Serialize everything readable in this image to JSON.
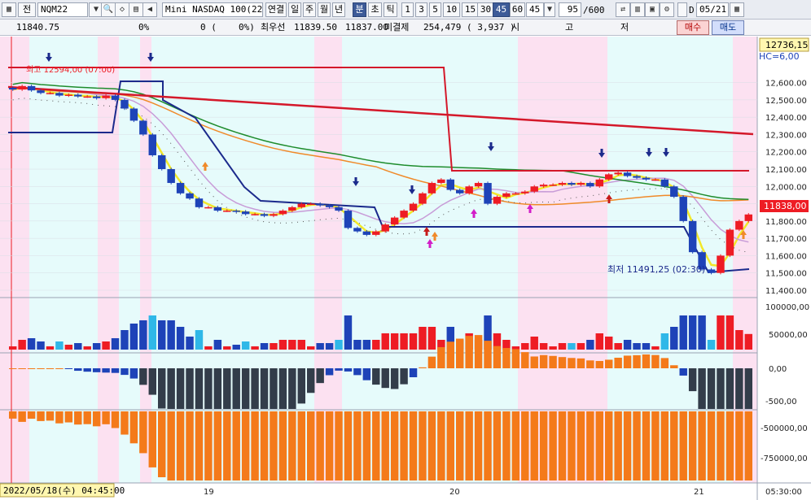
{
  "toolbar": {
    "code_prefix": "전",
    "code": "NQM22",
    "product": "Mini NASDAQ 100(22.0",
    "period_buttons": [
      "연결",
      "일",
      "주",
      "월",
      "년",
      "분",
      "초",
      "틱"
    ],
    "active_period": "분",
    "minute_buttons": [
      "1",
      "3",
      "5",
      "10",
      "15",
      "30",
      "45",
      "60"
    ],
    "active_minute": "45",
    "minute_input": "45",
    "count_input": "95",
    "count_total": "/600",
    "date_prefix": "D",
    "date": "05/21"
  },
  "quote": {
    "price": "11840.75",
    "pct": "0%",
    "change": "0 (",
    "change_pct": "0%)",
    "best_label": "최우선",
    "bid": "11839.50",
    "ask": "11837.00",
    "open_interest_label": "미결제",
    "open_interest": "254,479 ( 3,937 )",
    "open_label": "시",
    "high_label": "고",
    "low_label": "저",
    "buy": "매수",
    "sell": "매도"
  },
  "price_axis": {
    "ticks": [
      "12,600.00",
      "12,500.00",
      "12,400.00",
      "12,300.00",
      "12,200.00",
      "12,100.00",
      "12,000.00",
      "11,900.00",
      "11,800.00",
      "11,700.00",
      "11,600.00",
      "11,500.00",
      "11,400.00"
    ],
    "top_label": "12736,15",
    "indicator_label": "HC=6,00",
    "current_label": "11838,00"
  },
  "annotations": {
    "high_label": "최고 12594,00 (07:00)",
    "low_label": "최저 11491,25 (02:30)"
  },
  "volume_axis": {
    "ticks": [
      "100000,00",
      "50000,00"
    ]
  },
  "osc_axis": {
    "ticks": [
      "0,00",
      "-500,00"
    ]
  },
  "obv_axis": {
    "ticks": [
      "-500000,00",
      "-750000,00"
    ]
  },
  "time_axis": {
    "start_label": "2022/05/18(수) 04:45:00",
    "dates": [
      "19",
      "20",
      "21"
    ],
    "end_label": "05:30:00"
  },
  "colors": {
    "up": "#ee1c24",
    "down": "#1e43b8",
    "ma_yellow": "#f2e82a",
    "ma_purple": "#c89cd8",
    "ma_orange": "#f08a2a",
    "ma_green": "#1e8c2c",
    "ma_red": "#d4182a",
    "navy": "#1b2a8c",
    "osc_orange": "#f47a1a",
    "pink_band": "#fce1f1",
    "cyan_band": "#e6fbfb"
  },
  "chart_data": {
    "type": "candlestick",
    "title": "",
    "xlabel": "",
    "ylabel": "",
    "ylim": [
      11400,
      12650
    ],
    "x": [
      "05/18 04:45",
      "05/19",
      "05/20",
      "05/21"
    ],
    "series": [],
    "closes": [
      12560,
      12580,
      12555,
      12540,
      12540,
      12525,
      12530,
      12520,
      12520,
      12510,
      12525,
      12500,
      12450,
      12380,
      12300,
      12180,
      12100,
      12020,
      11960,
      11930,
      11880,
      11880,
      11860,
      11860,
      11855,
      11840,
      11840,
      11830,
      11840,
      11860,
      11880,
      11900,
      11900,
      11890,
      11880,
      11860,
      11760,
      11740,
      11720,
      11740,
      11780,
      11820,
      11860,
      11900,
      11960,
      12020,
      12040,
      11980,
      11960,
      12000,
      12020,
      11900,
      11940,
      11960,
      11960,
      11970,
      12000,
      12010,
      12010,
      12020,
      12010,
      12020,
      12000,
      12040,
      12070,
      12080,
      12060,
      12050,
      12040,
      12040,
      12000,
      11940,
      11800,
      11620,
      11520,
      11500,
      11600,
      11750,
      11800,
      11838
    ]
  }
}
